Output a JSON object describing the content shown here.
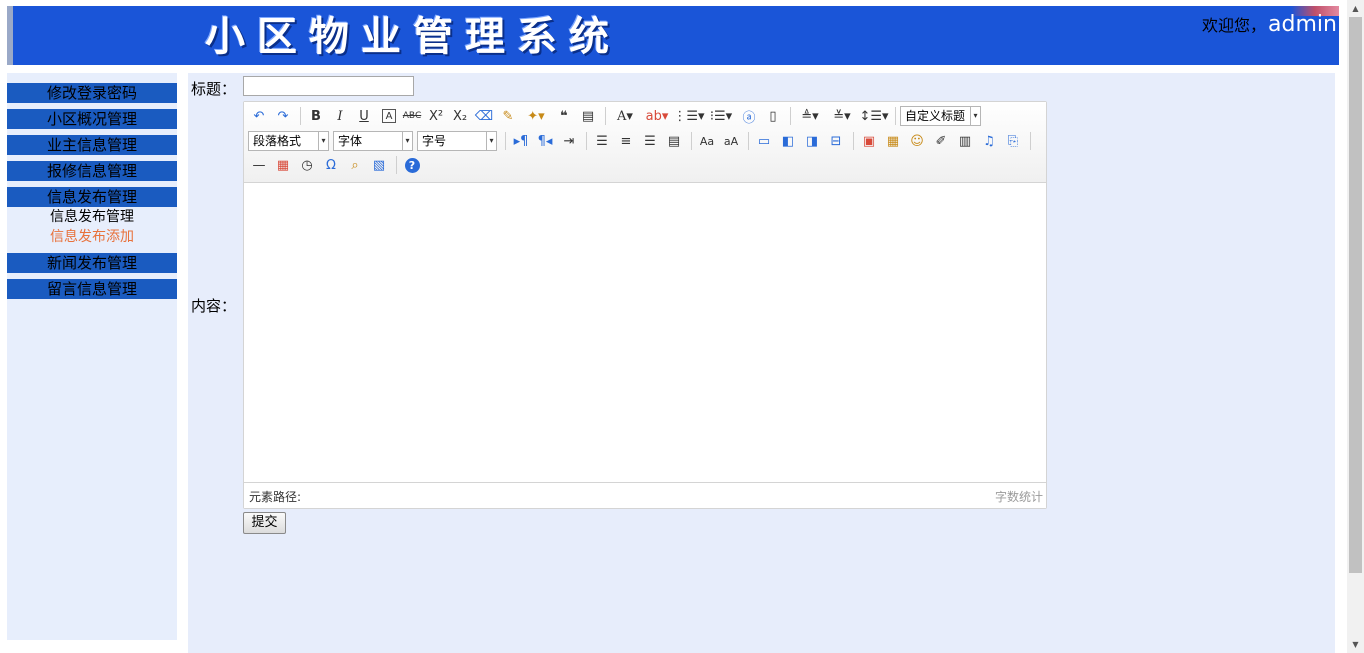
{
  "header": {
    "title": "小区物业管理系统",
    "welcome_label": "欢迎您，",
    "username": "admin"
  },
  "sidebar": {
    "items": [
      {
        "label": "修改登录密码"
      },
      {
        "label": "小区概况管理"
      },
      {
        "label": "业主信息管理"
      },
      {
        "label": "报修信息管理"
      },
      {
        "label": "信息发布管理"
      },
      {
        "label": "新闻发布管理"
      },
      {
        "label": "留言信息管理"
      }
    ],
    "subitems": [
      {
        "label": "信息发布管理"
      },
      {
        "label": "信息发布添加"
      }
    ]
  },
  "form": {
    "title_label": "标题：",
    "title_value": "",
    "content_label": "内容：",
    "submit_label": "提交"
  },
  "editor": {
    "custom_title": "自定义标题",
    "paragraph_format": "段落格式",
    "font_family": "字体",
    "font_size": "字号",
    "element_path_label": "元素路径:",
    "word_count_label": "字数统计"
  },
  "colors": {
    "banner": "#1a55d8",
    "menu_item": "#1a5bc0",
    "panel_bg": "#e7edfb",
    "active_subitem": "#e8723c"
  }
}
